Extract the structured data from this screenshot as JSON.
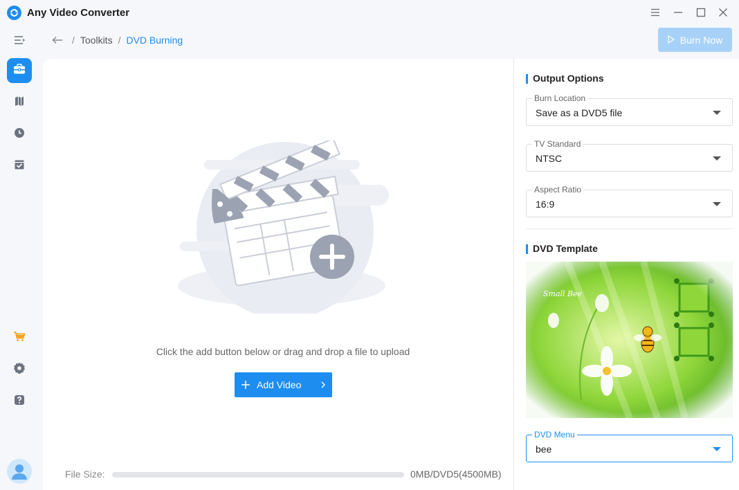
{
  "app": {
    "title": "Any Video Converter"
  },
  "breadcrumb": {
    "items": [
      "Toolkits",
      "DVD Burning"
    ]
  },
  "toolbar": {
    "burn_label": "Burn Now"
  },
  "main": {
    "hint": "Click the add button below or drag and drop a file to upload",
    "add_label": "Add Video",
    "file_size_label": "File Size:",
    "file_size_value": "0MB/DVD5(4500MB)",
    "file_size_fraction": 0
  },
  "output": {
    "heading": "Output Options",
    "burn_location": {
      "label": "Burn Location",
      "value": "Save as a DVD5 file"
    },
    "tv_standard": {
      "label": "TV Standard",
      "value": "NTSC"
    },
    "aspect_ratio": {
      "label": "Aspect Ratio",
      "value": "16:9"
    }
  },
  "template": {
    "heading": "DVD Template",
    "caption": "Small Bee",
    "menu": {
      "label": "DVD Menu",
      "value": "bee"
    }
  },
  "sidebar": {
    "items": [
      {
        "icon": "menu-collapse-icon"
      },
      {
        "icon": "toolbox-icon",
        "active": true
      },
      {
        "icon": "library-icon"
      },
      {
        "icon": "history-icon"
      },
      {
        "icon": "task-check-icon"
      },
      {
        "icon": "cart-icon"
      },
      {
        "icon": "settings-icon"
      },
      {
        "icon": "help-icon"
      }
    ]
  },
  "colors": {
    "accent": "#1d8df0",
    "accent_disabled": "#a8d1f7",
    "background": "#f5f7fb"
  }
}
